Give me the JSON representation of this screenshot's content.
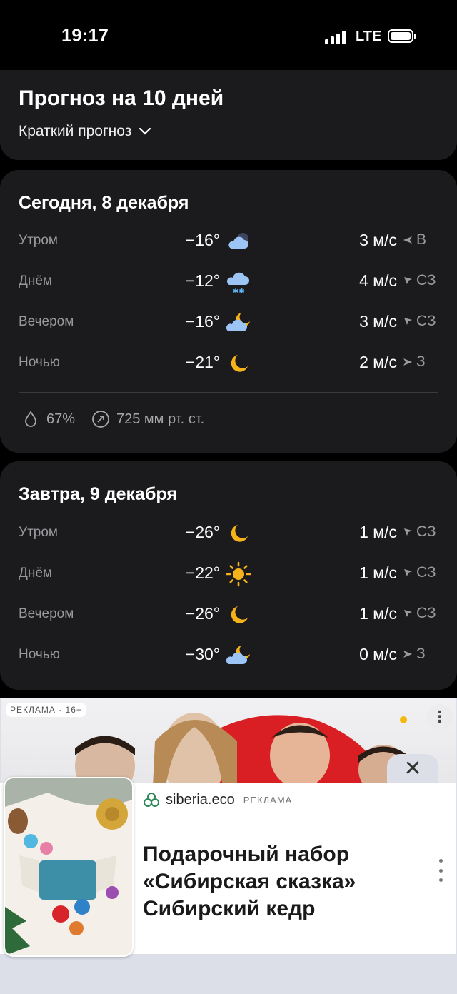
{
  "status_bar": {
    "time": "19:17",
    "network": "LTE"
  },
  "header": {
    "title": "Прогноз на 10 дней",
    "summary_toggle": "Краткий прогноз"
  },
  "today": {
    "title": "Сегодня, 8 декабря",
    "rows": [
      {
        "part": "Утром",
        "temp": "−16°",
        "icon": "night-cloudy-icon",
        "wind": "3 м/с",
        "dir": "В"
      },
      {
        "part": "Днём",
        "temp": "−12°",
        "icon": "snow-cloud-icon",
        "wind": "4 м/с",
        "dir": "СЗ"
      },
      {
        "part": "Вечером",
        "temp": "−16°",
        "icon": "partly-cloudy-night-icon",
        "wind": "3 м/с",
        "dir": "СЗ"
      },
      {
        "part": "Ночью",
        "temp": "−21°",
        "icon": "moon-icon",
        "wind": "2 м/с",
        "dir": "З"
      }
    ],
    "humidity": "67%",
    "pressure": "725 мм рт. ст."
  },
  "tomorrow": {
    "title": "Завтра, 9 декабря",
    "rows": [
      {
        "part": "Утром",
        "temp": "−26°",
        "icon": "moon-icon",
        "wind": "1 м/с",
        "dir": "СЗ"
      },
      {
        "part": "Днём",
        "temp": "−22°",
        "icon": "sun-icon",
        "wind": "1 м/с",
        "dir": "СЗ"
      },
      {
        "part": "Вечером",
        "temp": "−26°",
        "icon": "moon-icon",
        "wind": "1 м/с",
        "dir": "СЗ"
      },
      {
        "part": "Ночью",
        "temp": "−30°",
        "icon": "partly-cloudy-night-icon",
        "wind": "0 м/с",
        "dir": "З"
      }
    ]
  },
  "ad": {
    "age_label": "РЕКЛАМА · 16+",
    "close_symbol": "✕",
    "brand": "siberia.eco",
    "brand_label": "РЕКЛАМА",
    "headline_1": "Подарочный набор",
    "headline_2": "«Сибирская сказка»",
    "headline_3": "Сибирский кедр",
    "more_symbol": "⋮"
  },
  "colors": {
    "background": "#000000",
    "card": "#1b1b1d",
    "secondary_text": "#9a9a9e",
    "moon": "#f5b21a",
    "cloud": "#9cc4f5"
  }
}
